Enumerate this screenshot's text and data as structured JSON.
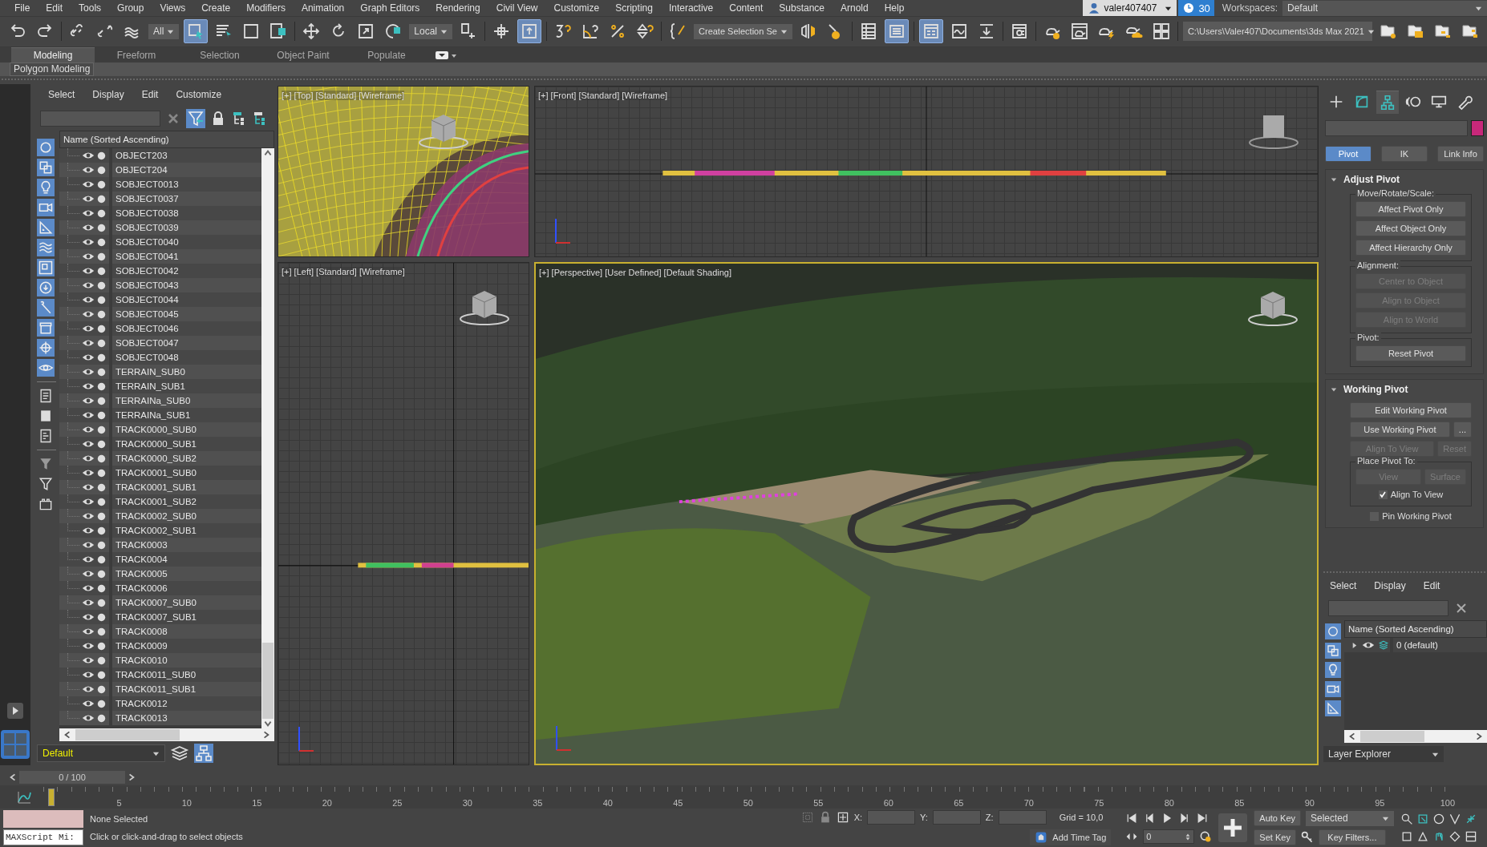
{
  "menu_bar": {
    "items": [
      "File",
      "Edit",
      "Tools",
      "Group",
      "Views",
      "Create",
      "Modifiers",
      "Animation",
      "Graph Editors",
      "Rendering",
      "Civil View",
      "Customize",
      "Scripting",
      "Interactive",
      "Content",
      "Substance",
      "Arnold",
      "Help"
    ]
  },
  "account": {
    "user": "valer407407",
    "timer": "30",
    "workspaces_label": "Workspaces:",
    "workspace": "Default"
  },
  "toolbar": {
    "selection_filter": "All",
    "coordinate_system": "Local",
    "named_selection": "Create Selection Se",
    "project_path": "C:\\Users\\Valer407\\Documents\\3ds Max 2021"
  },
  "ribbon": {
    "tabs": [
      {
        "label": "Modeling",
        "selected": true
      },
      {
        "label": "Freeform",
        "selected": false
      },
      {
        "label": "Selection",
        "selected": false
      },
      {
        "label": "Object Paint",
        "selected": false
      },
      {
        "label": "Populate",
        "selected": false
      }
    ],
    "panel": "Polygon Modeling"
  },
  "scene_explorer": {
    "menu": [
      "Select",
      "Display",
      "Edit",
      "Customize"
    ],
    "filters": [
      {
        "kind": "geometry",
        "on": true
      },
      {
        "kind": "shapes",
        "on": true
      },
      {
        "kind": "lights",
        "on": true
      },
      {
        "kind": "cameras",
        "on": true
      },
      {
        "kind": "helpers",
        "on": true
      },
      {
        "kind": "space_warps",
        "on": true
      },
      {
        "kind": "groups",
        "on": true
      },
      {
        "kind": "xrefs",
        "on": true
      },
      {
        "kind": "bones",
        "on": true
      },
      {
        "kind": "containers",
        "on": true
      },
      {
        "kind": "particles",
        "on": true
      },
      {
        "kind": "frozen",
        "on": true
      }
    ],
    "column": "Name (Sorted Ascending)",
    "rows": [
      "OBJECT203",
      "OBJECT204",
      "SOBJECT0013",
      "SOBJECT0037",
      "SOBJECT0038",
      "SOBJECT0039",
      "SOBJECT0040",
      "SOBJECT0041",
      "SOBJECT0042",
      "SOBJECT0043",
      "SOBJECT0044",
      "SOBJECT0045",
      "SOBJECT0046",
      "SOBJECT0047",
      "SOBJECT0048",
      "TERRAIN_SUB0",
      "TERRAIN_SUB1",
      "TERRAINa_SUB0",
      "TERRAINa_SUB1",
      "TRACK0000_SUB0",
      "TRACK0000_SUB1",
      "TRACK0000_SUB2",
      "TRACK0001_SUB0",
      "TRACK0001_SUB1",
      "TRACK0001_SUB2",
      "TRACK0002_SUB0",
      "TRACK0002_SUB1",
      "TRACK0003",
      "TRACK0004",
      "TRACK0005",
      "TRACK0006",
      "TRACK0007_SUB0",
      "TRACK0007_SUB1",
      "TRACK0008",
      "TRACK0009",
      "TRACK0010",
      "TRACK0011_SUB0",
      "TRACK0011_SUB1",
      "TRACK0012",
      "TRACK0013"
    ],
    "layer": "Default"
  },
  "viewports": [
    {
      "kind": "top",
      "label": "[+] [Top] [Standard] [Wireframe]",
      "active": false
    },
    {
      "kind": "front",
      "label": "[+] [Front] [Standard] [Wireframe]",
      "active": false
    },
    {
      "kind": "left",
      "label": "[+] [Left] [Standard] [Wireframe]",
      "active": false
    },
    {
      "kind": "perspective",
      "label": "[+] [Perspective] [User Defined] [Default Shading]",
      "active": true
    }
  ],
  "command_panel": {
    "tabs": [
      {
        "kind": "create",
        "selected": false
      },
      {
        "kind": "modify",
        "selected": false
      },
      {
        "kind": "hierarchy",
        "selected": true
      },
      {
        "kind": "motion",
        "selected": false
      },
      {
        "kind": "display",
        "selected": false
      },
      {
        "kind": "utilities",
        "selected": false
      }
    ],
    "modes": [
      {
        "label": "Pivot",
        "selected": true
      },
      {
        "label": "IK",
        "selected": false
      },
      {
        "label": "Link Info",
        "selected": false
      }
    ],
    "rollouts": [
      {
        "title": "Adjust Pivot",
        "expanded": true,
        "blocks": [
          {
            "kind": "group",
            "title": "Move/Rotate/Scale:",
            "rows": [
              [
                {
                  "kind": "button",
                  "label": "Affect Pivot Only",
                  "disabled": false
                }
              ],
              [
                {
                  "kind": "button",
                  "label": "Affect Object Only",
                  "disabled": false
                }
              ],
              [
                {
                  "kind": "button",
                  "label": "Affect Hierarchy Only",
                  "disabled": false
                }
              ]
            ]
          },
          {
            "kind": "group",
            "title": "Alignment:",
            "rows": [
              [
                {
                  "kind": "button",
                  "label": "Center to Object",
                  "disabled": true
                }
              ],
              [
                {
                  "kind": "button",
                  "label": "Align to Object",
                  "disabled": true
                }
              ],
              [
                {
                  "kind": "button",
                  "label": "Align to World",
                  "disabled": true
                }
              ]
            ]
          },
          {
            "kind": "group",
            "title": "Pivot:",
            "rows": [
              [
                {
                  "kind": "button",
                  "label": "Reset Pivot",
                  "disabled": false
                }
              ]
            ]
          }
        ]
      },
      {
        "title": "Working Pivot",
        "expanded": true,
        "blocks": [
          {
            "kind": "row",
            "items": [
              {
                "kind": "button",
                "label": "Edit Working Pivot",
                "disabled": false
              }
            ]
          },
          {
            "kind": "row",
            "items": [
              {
                "kind": "button",
                "label": "Use Working Pivot",
                "disabled": false
              },
              {
                "kind": "button",
                "label": "...",
                "disabled": false
              }
            ]
          },
          {
            "kind": "row",
            "items": [
              {
                "kind": "button",
                "label": "Align To View",
                "disabled": true
              },
              {
                "kind": "button",
                "label": "Reset",
                "disabled": true
              }
            ]
          },
          {
            "kind": "group",
            "title": "Place Pivot To:",
            "rows": [
              [
                {
                  "kind": "button",
                  "label": "View",
                  "disabled": true
                },
                {
                  "kind": "button",
                  "label": "Surface",
                  "disabled": true
                }
              ],
              [
                {
                  "kind": "checkbox",
                  "label": "Align To View",
                  "checked": true
                }
              ]
            ]
          },
          {
            "kind": "row",
            "items": [
              {
                "kind": "checkbox",
                "label": "Pin Working Pivot",
                "checked": false
              }
            ]
          }
        ]
      }
    ]
  },
  "layer_explorer": {
    "menu": [
      "Select",
      "Display",
      "Edit"
    ],
    "column": "Name (Sorted Ascending)",
    "rows": [
      {
        "name": "0 (default)",
        "expanded": false
      }
    ],
    "mode": "Layer Explorer"
  },
  "time_slider": {
    "position": "0 / 100",
    "level": 0,
    "ticks": [
      "5",
      "10",
      "15",
      "20",
      "25",
      "30",
      "35",
      "40",
      "45",
      "50",
      "55",
      "60",
      "65",
      "70",
      "75",
      "80",
      "85",
      "90",
      "95",
      "100"
    ]
  },
  "status_bar": {
    "selection": "None Selected",
    "prompt": "Click or click-and-drag to select objects",
    "listener": "MAXScript Mi:",
    "x_label": "X:",
    "y_label": "Y:",
    "z_label": "Z:",
    "grid": "Grid = 10,0",
    "add_time_tag": "Add Time Tag",
    "frame": "0",
    "auto_key": "Auto Key",
    "key_mode": "Selected",
    "set_key": "Set Key",
    "key_filters": "Key Filters..."
  }
}
